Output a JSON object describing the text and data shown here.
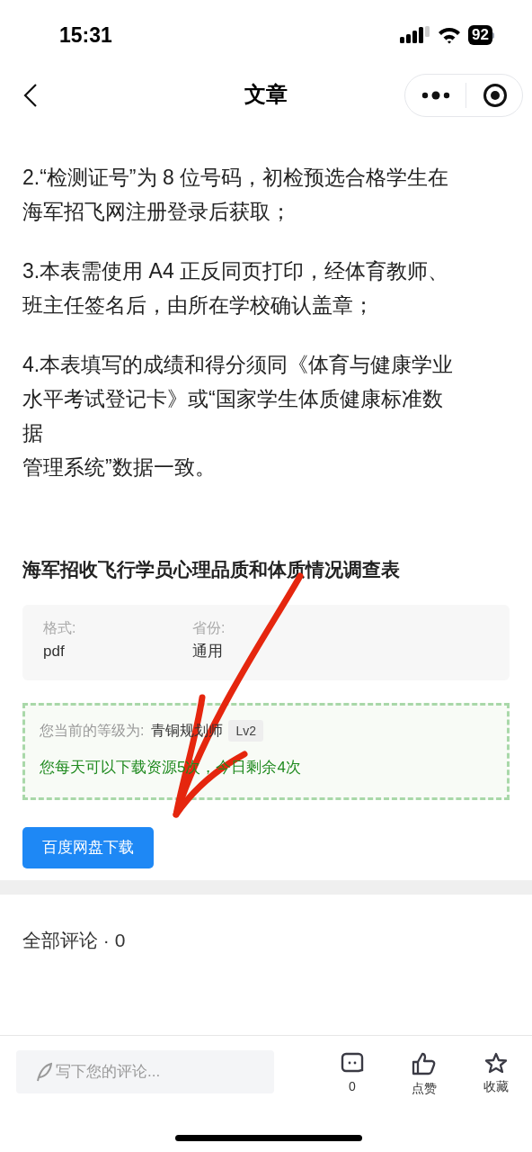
{
  "status_bar": {
    "time": "15:31",
    "battery": "92"
  },
  "header": {
    "title": "文章"
  },
  "paragraphs": [
    [
      "2.“检测证号”为 8 位号码，初检预选合格学生在海军招飞网注册登录后获取；"
    ],
    [
      "3.本表需使用 A4 正反同页打印，经体育教师、班主任签名后，由所在学校确认盖章；"
    ],
    [
      "4.本表填写的成绩和得分须同《体育与健康学业水平考试登记卡》或“国家学生体质健康标准数据",
      "管理系统”数据一致。"
    ]
  ],
  "resource": {
    "title": "海军招收飞行学员心理品质和体质情况调查表",
    "fields": [
      {
        "label": "格式:",
        "value": "pdf"
      },
      {
        "label": "省份:",
        "value": "通用"
      }
    ],
    "level_box": {
      "label": "您当前的等级为:",
      "level_name": "青铜规划师",
      "badge": "Lv2",
      "quota": "您每天可以下载资源5次，今日剩余4次"
    },
    "download_button": "百度网盘下载"
  },
  "comments": {
    "heading": "全部评论 · 0"
  },
  "bottom_bar": {
    "placeholder": "写下您的评论...",
    "actions": [
      {
        "kind": "comment",
        "label": "0"
      },
      {
        "kind": "like",
        "label": "点赞"
      },
      {
        "kind": "favorite",
        "label": "收藏"
      }
    ]
  }
}
